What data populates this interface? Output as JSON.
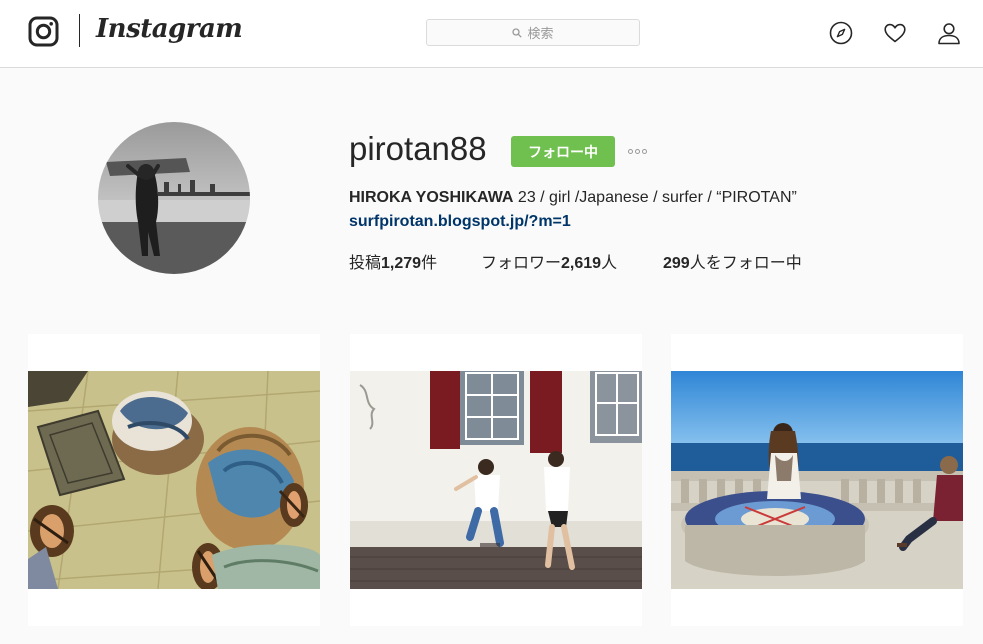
{
  "header": {
    "wordmark": "Instagram",
    "search": {
      "placeholder": "検索"
    },
    "icons": [
      "instagram-glyph-icon",
      "compass-icon",
      "heart-icon",
      "person-icon"
    ]
  },
  "profile": {
    "username": "pirotan88",
    "follow_button": "フォロー中",
    "full_name": "HIROKA YOSHIKAWA",
    "bio_text": " 23 / girl /Japanese / surfer / “PIROTAN”",
    "link": "surfpirotan.blogspot.jp/?m=1",
    "stats": {
      "posts_label": "投稿",
      "posts_count": "1,279",
      "posts_unit": "件",
      "followers_label": "フォロワー",
      "followers_count": "2,619",
      "followers_unit": "人",
      "following_count": "299",
      "following_label": "人をフォロー中"
    }
  },
  "posts": [
    {
      "subject": "beach-bags-and-sandals-photo"
    },
    {
      "subject": "couple-walking-past-red-shutters-photo"
    },
    {
      "subject": "woman-at-ocean-compass-table-photo"
    }
  ],
  "colors": {
    "follow_green": "#70c050",
    "link_blue": "#003569",
    "text": "#262626",
    "background": "#fafafa",
    "border": "#dbdbdb"
  }
}
